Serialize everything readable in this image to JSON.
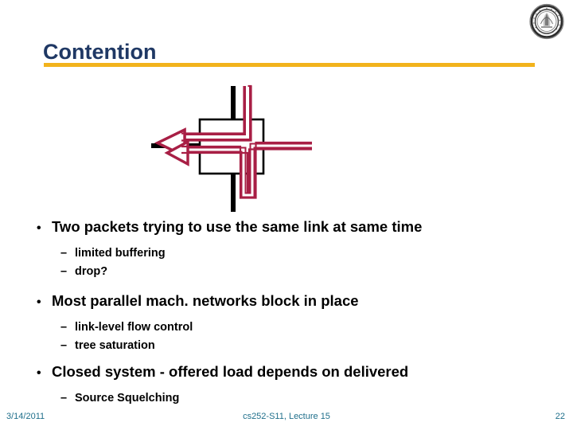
{
  "slide": {
    "title": "Contention",
    "title_color": "#1F3864",
    "rule_color": "#F2B31C",
    "background": "#ffffff"
  },
  "logo": {
    "name": "university-seal-logo",
    "alt": "university seal"
  },
  "diagram": {
    "name": "switch-contention-diagram",
    "description": "Network switch with two packets routed to the same west output link",
    "box_color": "#000000",
    "link_color": "#000000",
    "packet_color": "#A81F45",
    "packet_fill": "#ffffff",
    "arrows": [
      {
        "name": "packet-from-north",
        "from": "north",
        "to": "west"
      },
      {
        "name": "packet-from-east",
        "from": "east",
        "to": "west"
      }
    ]
  },
  "body": {
    "bullets": [
      {
        "level": 1,
        "marker": "•",
        "text": "Two packets trying to use the same link at same time"
      },
      {
        "level": 2,
        "marker": "–",
        "text": "limited buffering"
      },
      {
        "level": 2,
        "marker": "–",
        "text": "drop?"
      },
      {
        "level": 1,
        "marker": "•",
        "text": "Most parallel mach. networks block in place"
      },
      {
        "level": 2,
        "marker": "–",
        "text": "link-level flow control"
      },
      {
        "level": 2,
        "marker": "–",
        "text": "tree saturation"
      },
      {
        "level": 1,
        "marker": "•",
        "text": "Closed system - offered load depends on delivered"
      },
      {
        "level": 2,
        "marker": "–",
        "text": "Source Squelching"
      }
    ]
  },
  "footer": {
    "date": "3/14/2011",
    "center": "cs252-S11, Lecture 15",
    "page_number": "22",
    "color": "#1F6F8B"
  }
}
